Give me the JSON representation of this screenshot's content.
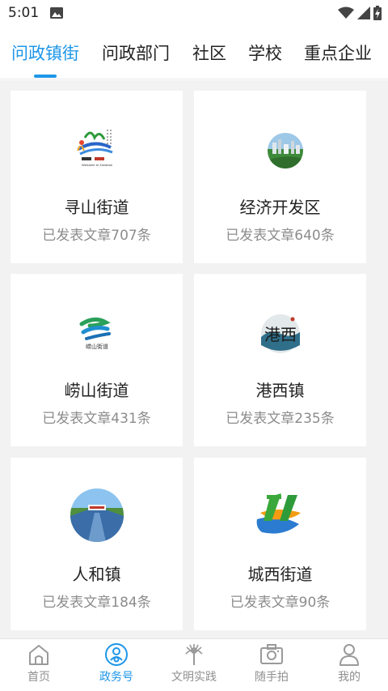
{
  "status_bar": {
    "time": "5:01",
    "icons": [
      "image-icon",
      "wifi-icon",
      "cell-signal-icon",
      "battery-charging-icon"
    ]
  },
  "tabs": [
    {
      "label": "问政镇街",
      "active": true
    },
    {
      "label": "问政部门",
      "active": false
    },
    {
      "label": "社区",
      "active": false
    },
    {
      "label": "学校",
      "active": false
    },
    {
      "label": "重点企业",
      "active": false
    }
  ],
  "cards": [
    {
      "title": "寻山街道",
      "subtitle": "已发表文章707条",
      "logo_text": "Welcome to Xunshan"
    },
    {
      "title": "经济开发区",
      "subtitle": "已发表文章640条"
    },
    {
      "title": "崂山街道",
      "subtitle": "已发表文章431条",
      "logo_text": "崂山街道"
    },
    {
      "title": "港西镇",
      "subtitle": "已发表文章235条",
      "logo_text": "港西"
    },
    {
      "title": "人和镇",
      "subtitle": "已发表文章184条"
    },
    {
      "title": "城西街道",
      "subtitle": "已发表文章90条"
    }
  ],
  "bottom_nav": [
    {
      "label": "首页",
      "icon": "home-icon",
      "active": false
    },
    {
      "label": "政务号",
      "icon": "government-account-icon",
      "active": true
    },
    {
      "label": "文明实践",
      "icon": "peacock-feather-icon",
      "active": false
    },
    {
      "label": "随手拍",
      "icon": "camera-icon",
      "active": false
    },
    {
      "label": "我的",
      "icon": "profile-icon",
      "active": false
    }
  ],
  "colors": {
    "accent": "#1E96E8",
    "text": "#222222",
    "muted": "#8c8c8c",
    "background": "#f2f2f2"
  }
}
